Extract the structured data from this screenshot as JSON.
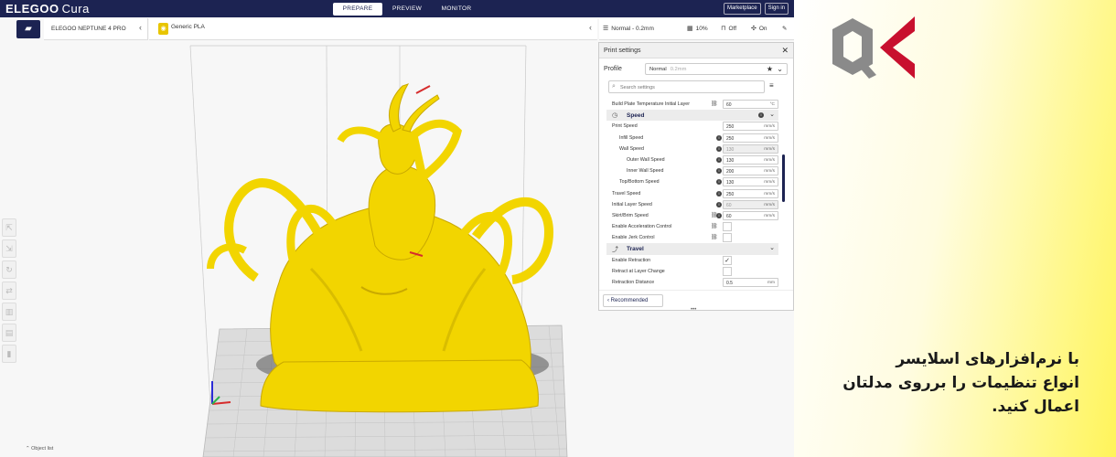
{
  "app": {
    "logo": {
      "brand": "ELEGOO",
      "product": "Cura"
    },
    "stages": [
      {
        "label": "PREPARE",
        "active": true
      },
      {
        "label": "PREVIEW",
        "active": false
      },
      {
        "label": "MONITOR",
        "active": false
      }
    ],
    "marketplace_label": "Marketplace",
    "signin_label": "Sign in",
    "printer": "ELEGOO NEPTUNE 4 PRO",
    "material": "Generic PLA",
    "summary": {
      "profile": "Normal - 0.2mm",
      "infill": "10%",
      "support": "Off",
      "adhesion": "On"
    },
    "object_list_label": "Object list"
  },
  "panel": {
    "title": "Print settings",
    "profile_label": "Profile",
    "profile_value": "Normal",
    "profile_sub": "0.2mm",
    "search_placeholder": "Search settings",
    "recommended_label": "Recommended",
    "rows": [
      {
        "type": "setting",
        "label": "Build Plate Temperature Initial Layer",
        "indent": 0,
        "value": "60",
        "unit": "°C",
        "link": true,
        "info": false
      },
      {
        "type": "category",
        "label": "Speed"
      },
      {
        "type": "setting",
        "label": "Print Speed",
        "indent": 0,
        "value": "250",
        "unit": "mm/s",
        "link": false,
        "info": false
      },
      {
        "type": "setting",
        "label": "Infill Speed",
        "indent": 1,
        "value": "250",
        "unit": "mm/s",
        "link": false,
        "info": true
      },
      {
        "type": "setting",
        "label": "Wall Speed",
        "indent": 1,
        "value": "130",
        "unit": "mm/s",
        "link": false,
        "info": true,
        "disabled": true
      },
      {
        "type": "setting",
        "label": "Outer Wall Speed",
        "indent": 2,
        "value": "130",
        "unit": "mm/s",
        "link": false,
        "info": true
      },
      {
        "type": "setting",
        "label": "Inner Wall Speed",
        "indent": 2,
        "value": "200",
        "unit": "mm/s",
        "link": false,
        "info": true
      },
      {
        "type": "setting",
        "label": "Top/Bottom Speed",
        "indent": 1,
        "value": "130",
        "unit": "mm/s",
        "link": false,
        "info": true
      },
      {
        "type": "setting",
        "label": "Travel Speed",
        "indent": 0,
        "value": "250",
        "unit": "mm/s",
        "link": false,
        "info": true
      },
      {
        "type": "setting",
        "label": "Initial Layer Speed",
        "indent": 0,
        "value": "60",
        "unit": "mm/s",
        "link": false,
        "info": true,
        "disabled": true
      },
      {
        "type": "setting",
        "label": "Skirt/Brim Speed",
        "indent": 0,
        "value": "60",
        "unit": "mm/s",
        "link": true,
        "info": true
      },
      {
        "type": "check",
        "label": "Enable Acceleration Control",
        "indent": 0,
        "checked": false,
        "link": true
      },
      {
        "type": "check",
        "label": "Enable Jerk Control",
        "indent": 0,
        "checked": false,
        "link": true
      },
      {
        "type": "category",
        "label": "Travel"
      },
      {
        "type": "check",
        "label": "Enable Retraction",
        "indent": 0,
        "checked": true,
        "link": false
      },
      {
        "type": "check",
        "label": "Retract at Layer Change",
        "indent": 0,
        "checked": false,
        "link": false
      },
      {
        "type": "setting",
        "label": "Retraction Distance",
        "indent": 0,
        "value": "0.5",
        "unit": "mm",
        "link": false,
        "info": false
      }
    ]
  },
  "promo": {
    "line1": "با نرم‌افزارهای اسلایسر",
    "line2": "انواع تنظیمات را برروی مدلتان اعمال کنید."
  },
  "colors": {
    "navy": "#1c2352",
    "model_yellow": "#f2d500",
    "logo_gray": "#8a8a8a",
    "logo_red": "#c8102e"
  },
  "icons": {
    "folder": "folder-icon",
    "material_badge": "material-badge-icon",
    "search": "search-icon",
    "star": "star-icon",
    "close": "close-icon"
  }
}
